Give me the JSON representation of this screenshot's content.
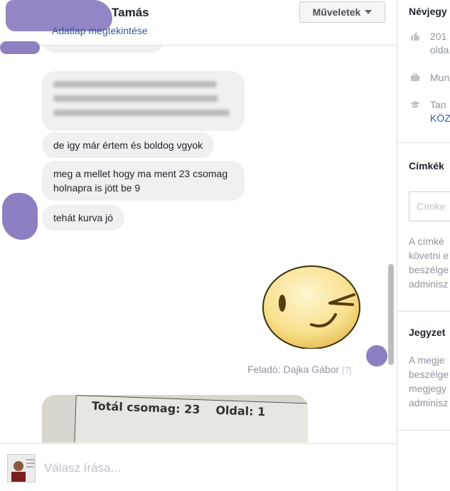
{
  "header": {
    "name": "Tamás",
    "profile_link": "Adatlap megtekintése",
    "actions_label": "Műveletek"
  },
  "messages": [
    {
      "text": "de igy már értem és boldog vgyok"
    },
    {
      "text": "meg a mellet hogy ma ment 23 csomag holnapra is jött be 9"
    },
    {
      "text": "tehát kurva jó"
    }
  ],
  "sender": {
    "prefix": "Feladó: Dajka Gábor",
    "help": "[?]"
  },
  "photo": {
    "label_total": "Totál csomag:  23",
    "label_page": "Oldal: 1"
  },
  "composer": {
    "placeholder": "Válasz írása..."
  },
  "sidebar": {
    "card_title": "Névjegy",
    "rows": [
      {
        "icon": "like-icon",
        "lines": [
          "201",
          "olda"
        ]
      },
      {
        "icon": "briefcase-icon",
        "lines": [
          "Mun"
        ]
      },
      {
        "icon": "graduation-cap-icon",
        "lines": [
          "Tan",
          "KÖZ"
        ]
      }
    ],
    "labels_title": "Címkék",
    "labels_placeholder": "Címke",
    "labels_desc": [
      "A címké",
      "követni e",
      "beszélge",
      "adminisz"
    ],
    "notes_title": "Jegyzet",
    "notes_desc": [
      "A megje",
      "beszélge",
      "megjegy",
      "adminisz"
    ]
  },
  "colors": {
    "link": "#365899",
    "bubble": "#f1f0f0",
    "redaction": "#8e7fc2"
  }
}
